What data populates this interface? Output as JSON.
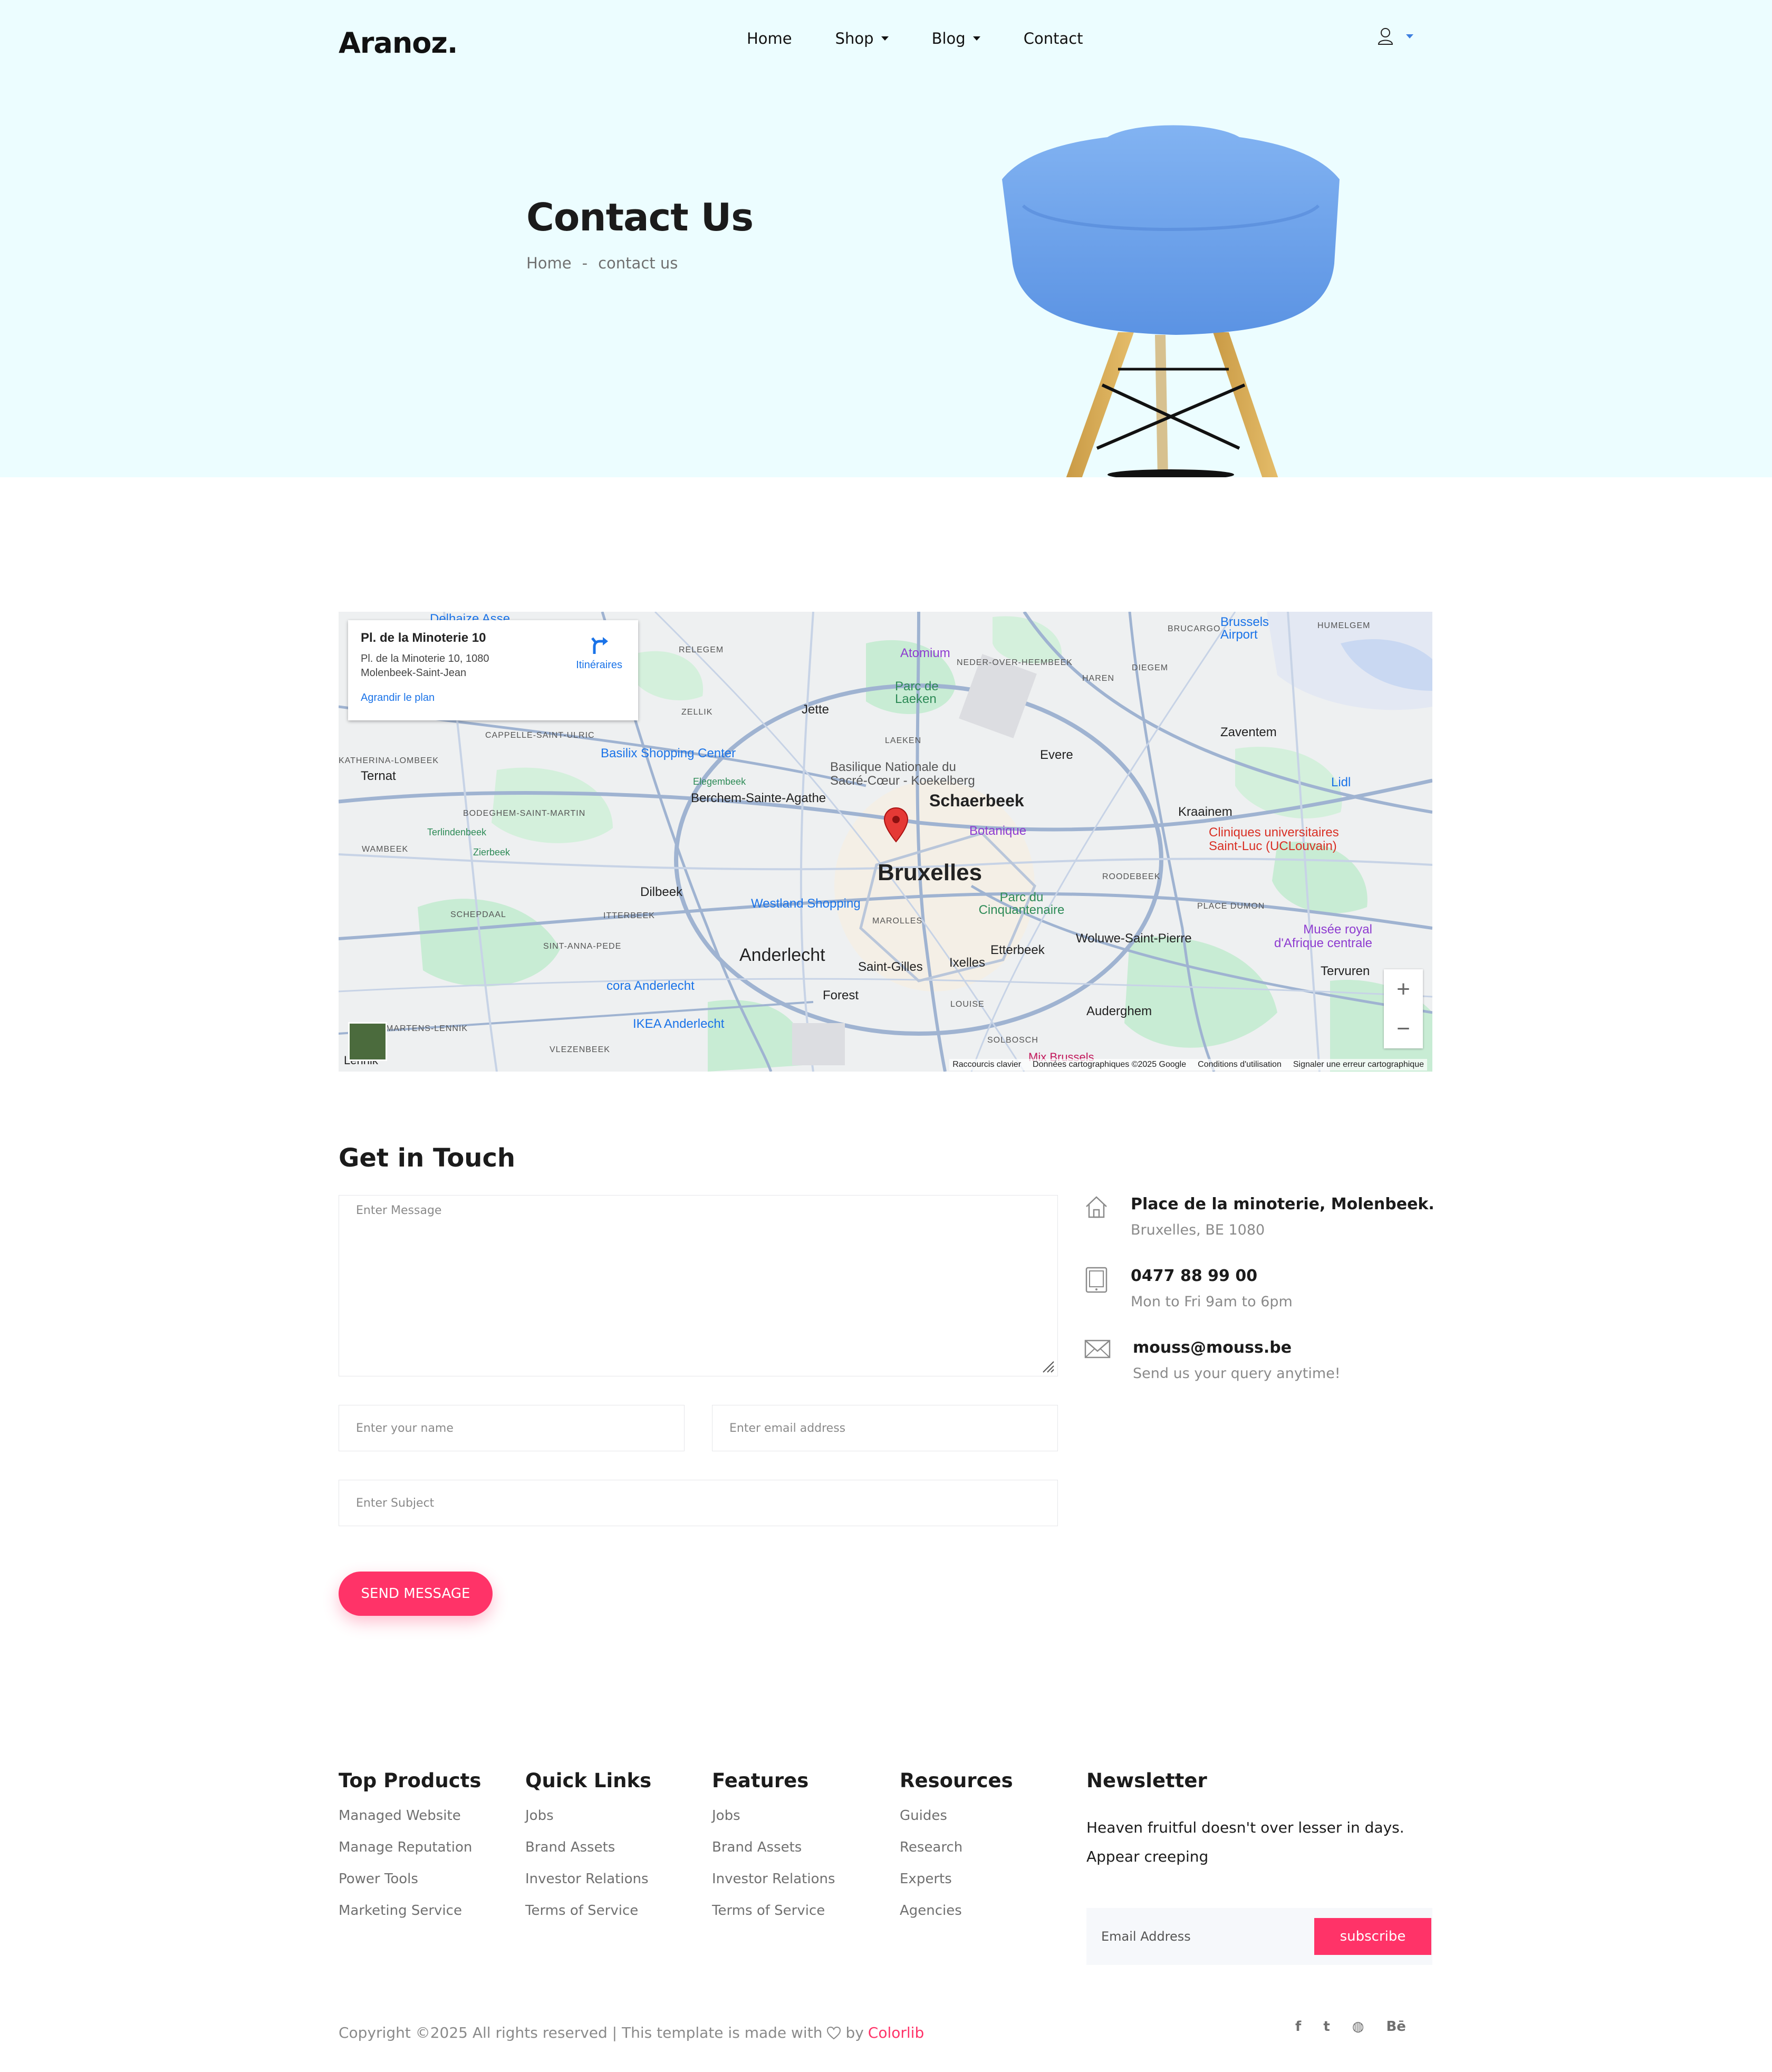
{
  "brand": {
    "logo": "Aranoz."
  },
  "nav": {
    "items": [
      "Home",
      "Shop",
      "Blog",
      "Contact"
    ]
  },
  "hero": {
    "title": "Contact Us",
    "breadcrumb": [
      "Home",
      "-",
      "contact us"
    ]
  },
  "map": {
    "place_title": "Pl. de la Minoterie 10",
    "place_address": "Pl. de la Minoterie 10, 1080 Molenbeek-Saint-Jean",
    "enlarge_link": "Agrandir le plan",
    "directions_label": "Itinéraires",
    "labels": {
      "bruxelles": "Bruxelles",
      "schaerbeek": "Schaerbeek",
      "anderlecht": "Anderlecht",
      "jette": "Jette",
      "evere": "Evere",
      "zaventem": "Zaventem",
      "kraainem": "Kraainem",
      "dilbeek": "Dilbeek",
      "ternat": "Ternat",
      "berchem": "Berchem-Sainte-Agathe",
      "forest": "Forest",
      "saint_gilles": "Saint-Gilles",
      "ixelles": "Ixelles",
      "etterbeek": "Etterbeek",
      "woluwe": "Woluwe-Saint-Pierre",
      "auderghem": "Auderghem",
      "tervuren": "Tervuren",
      "atomium": "Atomium",
      "botanique": "Botanique",
      "basilix": "Basilix Shopping Center",
      "westland": "Westland Shopping",
      "cora": "cora Anderlecht",
      "ikea": "IKEA Anderlecht",
      "basilique": "Basilique Nationale du Sacré-Cœur - Koekelberg",
      "cliniques": "Cliniques universitaires Saint-Luc (UCLouvain)",
      "airport": "Brussels Airport",
      "parc_laeken": "Parc de Laeken",
      "parc_cinq": "Parc du Cinquantenaire",
      "musee": "Musée royal d'Afrique centrale",
      "lidl": "Lidl",
      "delhaize": "Delhaize Asse",
      "mix": "Mix Brussels",
      "lennik": "Lennik",
      "elegem": "Elegembeek",
      "terlinden": "Terlindenbeek",
      "zierbeek": "Zierbeek",
      "relegem": "RELEGEM",
      "zellik": "ZELLIK",
      "laeken": "LAEKEN",
      "haren": "HAREN",
      "diegem": "DIEGEM",
      "brucargo": "BRUCARGO",
      "humelgem": "HUMELGEM",
      "ned": "NEDER-OVER-HEEMBEEK",
      "cappelle": "CAPPELLE-SAINT-ULRIC",
      "katherina": "KATHERINA-LOMBEEK",
      "bodeghem": "BODEGHEM-SAINT-MARTIN",
      "wambeek": "WAMBEEK",
      "schepdaal": "SCHEPDAAL",
      "itterbeek": "ITTERBEEK",
      "sint_anna": "SINT-ANNA-PEDE",
      "marolles": "MAROLLES",
      "roodebeek": "ROODEBEEK",
      "place_dumon": "PLACE DUMON",
      "louise": "LOUISE",
      "solbosch": "SOLBOSCH",
      "vlezenbeek": "VLEZENBEEK",
      "martens": "MARTENS-LENNIK"
    },
    "footer": [
      "Raccourcis clavier",
      "Données cartographiques ©2025 Google",
      "Conditions d'utilisation",
      "Signaler une erreur cartographique"
    ],
    "zoom_in": "+",
    "zoom_out": "−"
  },
  "form": {
    "title": "Get in Touch",
    "message_placeholder": "Enter Message",
    "name_placeholder": "Enter your name",
    "email_placeholder": "Enter email address",
    "subject_placeholder": "Enter Subject",
    "submit_label": "SEND MESSAGE"
  },
  "contact_info": [
    {
      "icon": "home-icon",
      "title": "Place de la minoterie, Molenbeek.",
      "sub": "Bruxelles, BE 1080"
    },
    {
      "icon": "tablet-icon",
      "title": "0477 88 99 00",
      "sub": "Mon to Fri 9am to 6pm"
    },
    {
      "icon": "email-icon",
      "title": "mouss@mouss.be",
      "sub": "Send us your query anytime!"
    }
  ],
  "footer": {
    "columns": [
      {
        "title": "Top Products",
        "links": [
          "Managed Website",
          "Manage Reputation",
          "Power Tools",
          "Marketing Service"
        ]
      },
      {
        "title": "Quick Links",
        "links": [
          "Jobs",
          "Brand Assets",
          "Investor Relations",
          "Terms of Service"
        ]
      },
      {
        "title": "Features",
        "links": [
          "Jobs",
          "Brand Assets",
          "Investor Relations",
          "Terms of Service"
        ]
      },
      {
        "title": "Resources",
        "links": [
          "Guides",
          "Research",
          "Experts",
          "Agencies"
        ]
      }
    ],
    "newsletter": {
      "title": "Newsletter",
      "text": "Heaven fruitful doesn't over lesser in days. Appear creeping",
      "placeholder": "Email Address",
      "button": "subscribe"
    },
    "copyright": "Copyright ©2025 All rights reserved | This template is made with",
    "by": "by",
    "credit": "Colorlib",
    "social": [
      "facebook-icon",
      "twitter-icon",
      "globe-icon",
      "behance-icon"
    ],
    "social_glyphs": [
      "f",
      "t",
      "◍",
      "Bē"
    ]
  },
  "colors": {
    "accent": "#ff3368",
    "hero_bg": "#ecfdff",
    "chair": "#6fa3ec"
  }
}
